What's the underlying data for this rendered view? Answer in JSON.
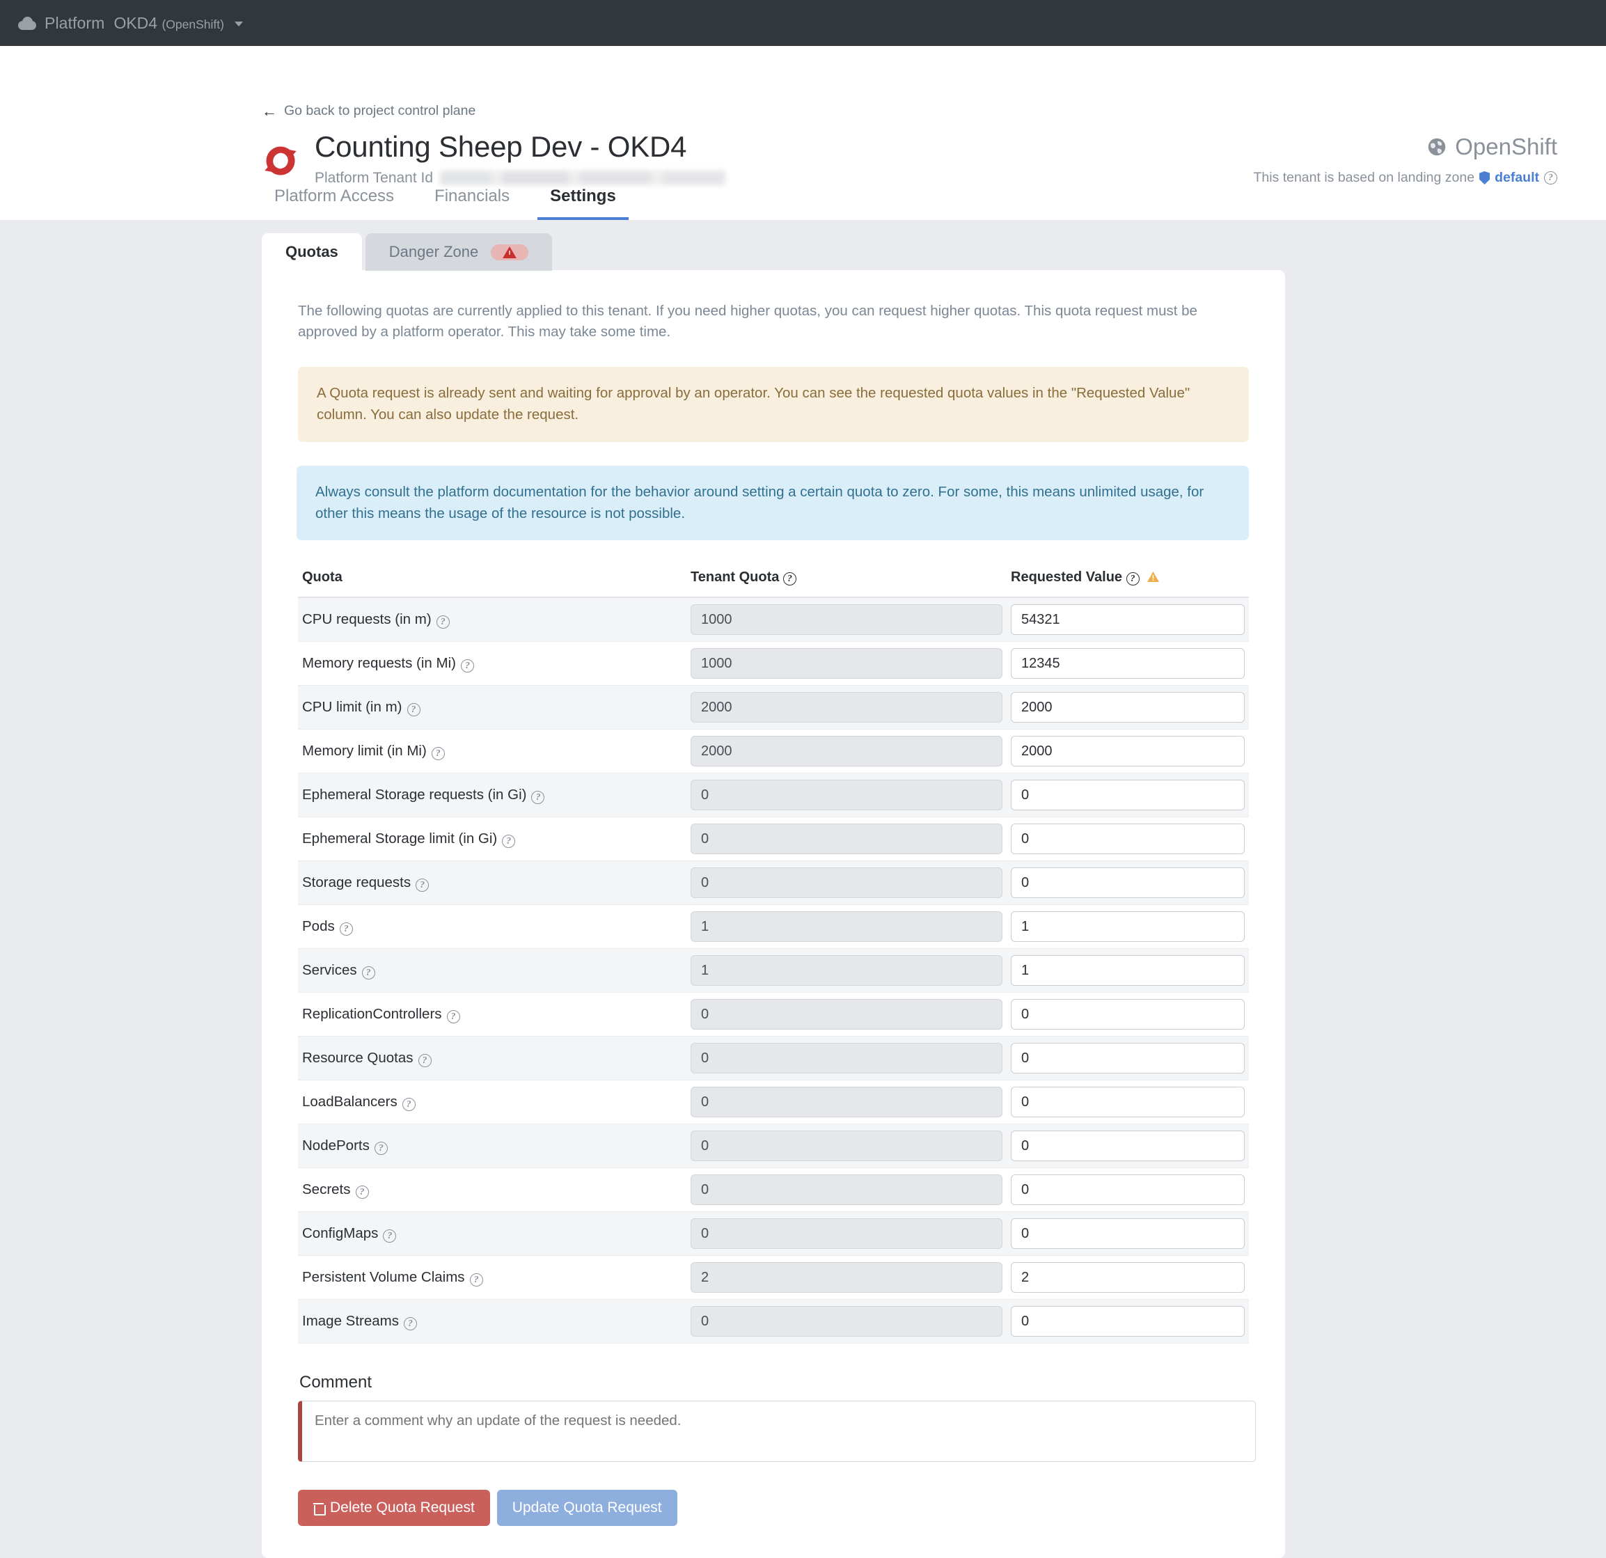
{
  "navbar": {
    "cloud_icon": "cloud-icon",
    "brand": "Platform",
    "env_name": "OKD4",
    "env_kind": "(OpenShift)",
    "caret_icon": "chevron-down-icon"
  },
  "header": {
    "back_link": "Go back to project control plane",
    "back_icon": "arrow-left-icon",
    "logo_icon": "openshift-logo-icon",
    "title": "Counting Sheep Dev - OKD4",
    "tenant_id_label": "Platform Tenant Id",
    "tenant_id_value": "",
    "platform_name": "OpenShift",
    "platform_icon": "globe-icon",
    "landing_zone_text": "This tenant is based on landing zone",
    "landing_zone_icon": "shield-icon",
    "landing_zone_link": "default",
    "landing_zone_help_icon": "question-circle-icon"
  },
  "main_tabs": [
    {
      "label": "Platform Access",
      "active": false
    },
    {
      "label": "Financials",
      "active": false
    },
    {
      "label": "Settings",
      "active": true
    }
  ],
  "sub_tabs": [
    {
      "label": "Quotas",
      "active": true,
      "badge_icon": null
    },
    {
      "label": "Danger Zone",
      "active": false,
      "badge_icon": "warning-triangle-icon"
    }
  ],
  "quotas_panel": {
    "lead_text": "The following quotas are currently applied to this tenant. If you need higher quotas, you can request higher quotas. This quota request must be approved by a platform operator. This may take some time.",
    "alert_warning": "A Quota request is already sent and waiting for approval by an operator. You can see the requested quota values in the \"Requested Value\" column. You can also update the request.",
    "alert_info": "Always consult the platform documentation for the behavior around setting a certain quota to zero. For some, this means unlimited usage, for other this means the usage of the resource is not possible.",
    "table": {
      "columns": [
        {
          "label": "Quota",
          "help_icon": null,
          "warn_icon": null
        },
        {
          "label": "Tenant Quota",
          "help_icon": "question-circle-icon",
          "warn_icon": null
        },
        {
          "label": "Requested Value",
          "help_icon": "question-circle-icon",
          "warn_icon": "warning-triangle-icon"
        }
      ],
      "rows": [
        {
          "name": "CPU requests (in m)",
          "tenant_quota": "1000",
          "requested_value": "54321"
        },
        {
          "name": "Memory requests (in Mi)",
          "tenant_quota": "1000",
          "requested_value": "12345"
        },
        {
          "name": "CPU limit (in m)",
          "tenant_quota": "2000",
          "requested_value": "2000"
        },
        {
          "name": "Memory limit (in Mi)",
          "tenant_quota": "2000",
          "requested_value": "2000"
        },
        {
          "name": "Ephemeral Storage requests (in Gi)",
          "tenant_quota": "0",
          "requested_value": "0"
        },
        {
          "name": "Ephemeral Storage limit (in Gi)",
          "tenant_quota": "0",
          "requested_value": "0"
        },
        {
          "name": "Storage requests",
          "tenant_quota": "0",
          "requested_value": "0"
        },
        {
          "name": "Pods",
          "tenant_quota": "1",
          "requested_value": "1"
        },
        {
          "name": "Services",
          "tenant_quota": "1",
          "requested_value": "1"
        },
        {
          "name": "ReplicationControllers",
          "tenant_quota": "0",
          "requested_value": "0"
        },
        {
          "name": "Resource Quotas",
          "tenant_quota": "0",
          "requested_value": "0"
        },
        {
          "name": "LoadBalancers",
          "tenant_quota": "0",
          "requested_value": "0"
        },
        {
          "name": "NodePorts",
          "tenant_quota": "0",
          "requested_value": "0"
        },
        {
          "name": "Secrets",
          "tenant_quota": "0",
          "requested_value": "0"
        },
        {
          "name": "ConfigMaps",
          "tenant_quota": "0",
          "requested_value": "0"
        },
        {
          "name": "Persistent Volume Claims",
          "tenant_quota": "2",
          "requested_value": "2"
        },
        {
          "name": "Image Streams",
          "tenant_quota": "0",
          "requested_value": "0"
        }
      ]
    },
    "comment": {
      "label": "Comment",
      "placeholder": "Enter a comment why an update of the request is needed.",
      "value": ""
    },
    "buttons": {
      "delete_label": "Delete Quota Request",
      "delete_icon": "trash-icon",
      "update_label": "Update Quota Request"
    }
  },
  "colors": {
    "navbar_bg": "#32373c",
    "accent_blue": "#4a7fd4",
    "danger_red": "#c9605c",
    "primary_blue": "#8eaede",
    "warn_bg": "#f8efdf",
    "info_bg": "#daeefa",
    "page_bg": "#eaebee"
  }
}
